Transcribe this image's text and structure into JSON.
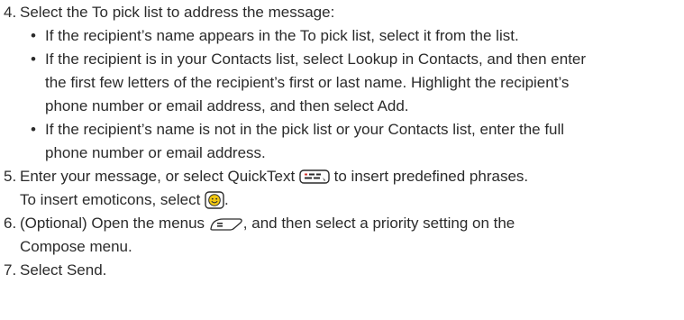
{
  "steps": [
    {
      "number": "4.",
      "text": "Select the To pick list to address the message:",
      "bullets": [
        {
          "lines": [
            "If the recipient’s name appears in the To pick list, select it from the list."
          ]
        },
        {
          "lines": [
            "If the recipient is in your Contacts list, select Lookup in Contacts, and then enter",
            "the first few letters of the recipient’s first or last name. Highlight the recipient’s",
            "phone number or email address, and  then select Add."
          ]
        },
        {
          "lines": [
            "If the recipient’s name is not in the pick list or your Contacts list, enter the full",
            "phone number or email address."
          ]
        }
      ]
    },
    {
      "number": "5.",
      "line1_before_icon": "Enter your message, or select QuickText",
      "line1_after_icon": "to insert predefined phrases.",
      "line2_before_icon": "To insert emoticons, select",
      "line2_after_icon": ".",
      "icons": [
        "quicktext-icon",
        "emoticon-icon"
      ]
    },
    {
      "number": "6.",
      "line1_before_icon": "(Optional) Open the menus",
      "line1_after_icon": ", and then select a priority setting on the",
      "line2": "Compose  menu.",
      "icons": [
        "menu-key-icon"
      ]
    },
    {
      "number": "7.",
      "text": "Select Send."
    }
  ],
  "bullet_glyph": "•",
  "colors": {
    "text": "#2b2b2b",
    "emoticon_fill": "#f2c811"
  }
}
